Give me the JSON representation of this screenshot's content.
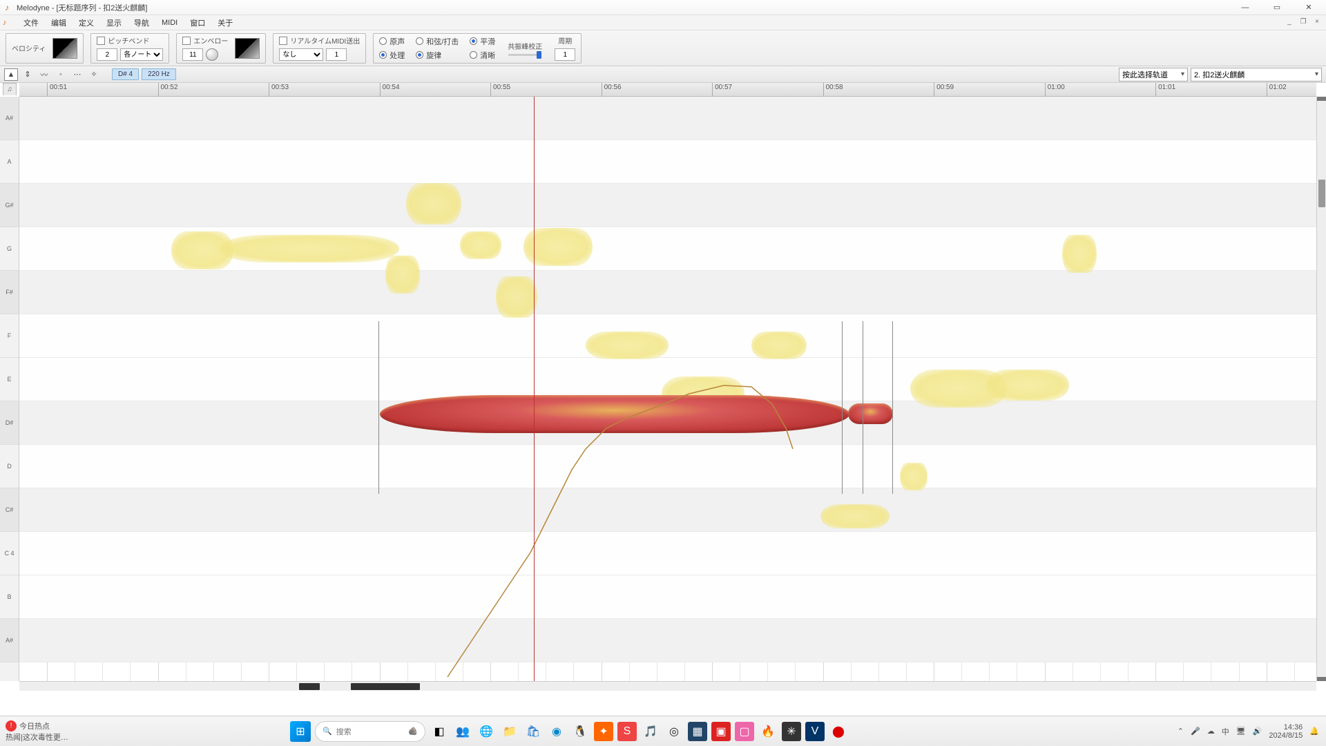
{
  "titlebar": {
    "title": "Melodyne - [无标题序列 - 扣2送火麒麟]"
  },
  "menu": {
    "file": "文件",
    "edit": "编辑",
    "define": "定义",
    "display": "显示",
    "nav": "导航",
    "midi": "MIDI",
    "window": "窗口",
    "about": "关于"
  },
  "params": {
    "velocity_label": "ベロシティ",
    "pitchbend_label": "ピッチベンド",
    "pitchbend_value": "2",
    "pitchbend_mode": "各ノート",
    "envelope_label": "エンベロー",
    "envelope_value": "11",
    "realtime_label": "リアルタイムMIDI送出",
    "realtime_mode": "なし",
    "realtime_value": "1",
    "radio": {
      "original": "原声",
      "harmony": "和弦/打击",
      "smooth": "平滑",
      "process": "处理",
      "spinner": "旋律",
      "clear": "清晰"
    },
    "formant_label": "共振峰校正",
    "period_label": "周期",
    "period_value": "1"
  },
  "toolstrip": {
    "note_chip": "D# 4",
    "freq_chip": "220 Hz",
    "track_select_placeholder": "按此选择轨道",
    "track_selected": "2. 扣2送火麒麟"
  },
  "ruler": {
    "times": [
      "00:51",
      "00:52",
      "00:53",
      "00:54",
      "00:55",
      "00:56",
      "00:57",
      "00:58",
      "00:59",
      "01:00",
      "01:01",
      "01:02"
    ]
  },
  "piano": {
    "keys": [
      "A#",
      "A",
      "G#",
      "G",
      "F#",
      "F",
      "E",
      "D#",
      "D",
      "C#",
      "C  4",
      "B",
      "A#"
    ]
  },
  "taskbar": {
    "hot_label": "今日热点",
    "news_text": "热闻|这次毒性更…",
    "search_placeholder": "搜索",
    "time": "14:36",
    "date": "2024/8/15"
  }
}
